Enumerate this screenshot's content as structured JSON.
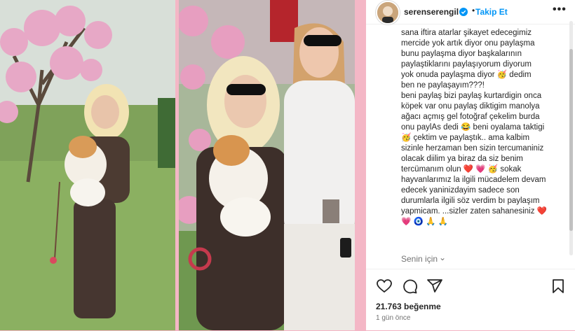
{
  "post": {
    "username": "serenserengil",
    "follow_label": "Takip Et",
    "more_label": "•••",
    "caption": "sana iftira atarlar şikayet edecegimiz\nmercide yok artık diyor onu paylaşma\nbunu paylaşma diyor başkalarının\npaylaştiklarını paylaşıyorum diyorum\nyok onuda paylaşma diyor 🥳  dedim\nben ne paylaşayım???!\nbeni paylaş bizi paylaş kurtardigin onca\nköpek var onu paylaş diktigim manolya\nağacı açmış gel fotoğraf çekelim burda\nonu paylAs dedi 😂 beni oyalama taktigi\n🥳 çektim ve paylaştık.. ama kalbim\nsizinle herzaman ben sizin tercumaniniz\nolacak diilim ya biraz da siz benim\ntercümanım olun ❤️ 💗 🥳  sokak\nhayvanlarımız la ilgili mücadelem devam\nedecek yaninizdayim sadece son\ndurumlarla ilgili söz verdim bı paylaşım\nyapmicam. ...sizler zaten sahanesiniz ❤️\n💗 🧿 🙏 🙏",
    "for_you_label": "Senin için",
    "likes": "21.763 beğenme",
    "time_ago": "1 gün önce"
  },
  "colors": {
    "accent": "#0095f6",
    "text": "#262626",
    "muted": "#737373",
    "backdrop": "#f4b7c6"
  },
  "icons": [
    "verified-badge-icon",
    "more-options-icon",
    "heart-icon",
    "comment-icon",
    "share-icon",
    "bookmark-icon",
    "chevron-down-icon"
  ]
}
